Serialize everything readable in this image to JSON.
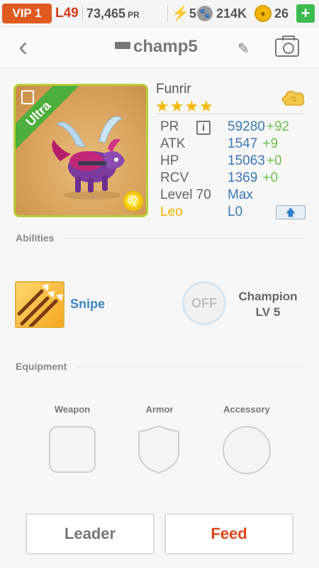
{
  "status_bar": {
    "vip": "VIP 1",
    "level": "L49",
    "power": "73,465",
    "power_unit": "PR",
    "energy": "5",
    "food": "214K",
    "gems": "26",
    "add": "+"
  },
  "header": {
    "title": "champ5",
    "back_icon": "chevron-left-icon",
    "edit_icon": "pencil-icon",
    "camera_icon": "camera-icon"
  },
  "dragon": {
    "rarity": "Ultra",
    "name": "Funrir",
    "stars": "★★★★",
    "star_count": 4,
    "element_icon": "wind-element-icon",
    "zodiac_symbol": "♌",
    "stats": [
      {
        "key": "PR",
        "value": "59280",
        "delta": "+92"
      },
      {
        "key": "ATK",
        "value": "1547",
        "delta": " +9"
      },
      {
        "key": "HP",
        "value": "15063",
        "delta": "+0"
      },
      {
        "key": "RCV",
        "value": "1369",
        "delta": " +0"
      }
    ],
    "level_label": "Level 70",
    "level_value": "Max",
    "zodiac_label": "Leo",
    "zodiac_value": "L0",
    "info_icon": "i",
    "upgrade_icon": "🡅"
  },
  "abilities": {
    "section_label": "Abilities",
    "ability_name": "Snipe",
    "toggle_label": "OFF",
    "champion_title": "Champion",
    "champion_level": "LV 5"
  },
  "equipment": {
    "section_label": "Equipment",
    "weapon_label": "Weapon",
    "armor_label": "Armor",
    "accessory_label": "Accessory"
  },
  "actions": {
    "leader_label": "Leader",
    "feed_label": "Feed"
  },
  "colors": {
    "vip_bg": "#e05a1f",
    "level_text": "#d63b1a",
    "value_blue": "#3a78b6",
    "delta_green": "#6cc04a",
    "feed_red": "#e0461b",
    "rarity_green": "#4cae3c",
    "zodiac_yellow": "#f5b800"
  }
}
